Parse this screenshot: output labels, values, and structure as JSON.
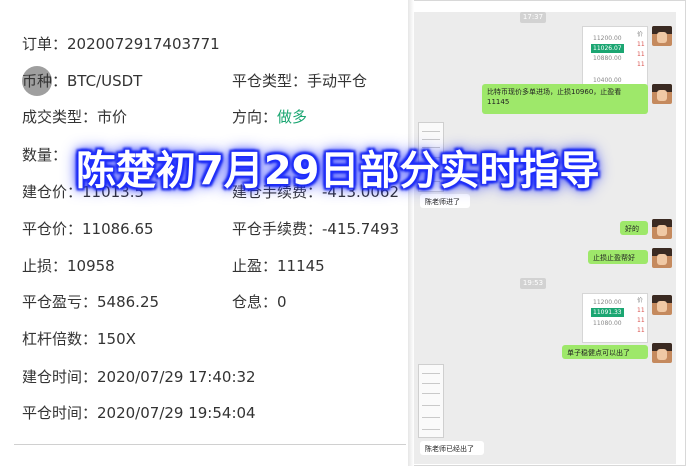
{
  "order": {
    "order_id": "订单：2020072917403771",
    "symbol": "币种：BTC/USDT",
    "close_type": "平仓类型：手动平仓",
    "trade_type": "成交类型：市价",
    "direction_label": "方向：",
    "direction_value": "做多",
    "quantity": "数量：",
    "open_price": "建仓价：11013.5",
    "open_fee": "建仓手续费：-413.0062",
    "close_price": "平仓价：11086.65",
    "close_fee": "平仓手续费：-415.7493",
    "stop_loss": "止损：10958",
    "take_profit": "止盈：11145",
    "pnl": "平仓盈亏：5486.25",
    "interest": "仓息：0",
    "leverage": "杠杆倍数：150X",
    "open_time": "建仓时间：2020/07/29 17:40:32",
    "close_time": "平仓时间：2020/07/29 19:54:04"
  },
  "chat": {
    "time_1": "17:37",
    "chart1_price": "11026.07",
    "chart1_ticks": [
      "11200.00",
      "10880.00",
      "10400.00"
    ],
    "chart1_side": [
      "价",
      "11",
      "11",
      "11"
    ],
    "msg_entry": "比特币现价多单进场，止损10960，止盈看11145",
    "msg_followed": "陈老师进了",
    "msg_good": "好的",
    "msg_tp": "止损止盈帮好",
    "time_2": "19:53",
    "chart2_price": "11091.33",
    "chart2_ticks": [
      "11200.00",
      "11080.00"
    ],
    "chart2_side": [
      "价",
      "11",
      "11",
      "11"
    ],
    "msg_exit": "单子稳健点可以出了",
    "msg_closed": "陈老师已经出了"
  },
  "banner": {
    "text": "陈楚初7月29日部分实时指导"
  },
  "colors": {
    "long_green": "#1ba672",
    "bubble_green": "#9ee86a",
    "chat_bg": "#ececec",
    "banner_glow": "#1d2dff"
  }
}
